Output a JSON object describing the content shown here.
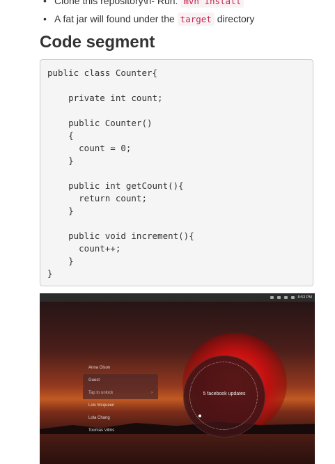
{
  "bullets": [
    {
      "text": "Clone this repository\\n- Run: ",
      "code": "mvn install",
      "after": ""
    },
    {
      "text": "A fat jar will found under the ",
      "code": "target",
      "after": " directory"
    }
  ],
  "heading": "Code segment",
  "code": "public class Counter{\n\n    private int count;\n\n    public Counter()\n    {\n      count = 0;\n    }\n\n    public int getCount(){\n      return count;\n    }\n\n    public void increment(){\n      count++;\n    }\n}",
  "screenshot": {
    "time": "8:53 PM",
    "users": [
      "Anna Olson",
      "Guest",
      "Tap to unlock",
      "Lois Mcqueen",
      "Lola Chang",
      "Toomas Vilms"
    ],
    "chevron": "›",
    "notification": "5 facebook updates"
  }
}
